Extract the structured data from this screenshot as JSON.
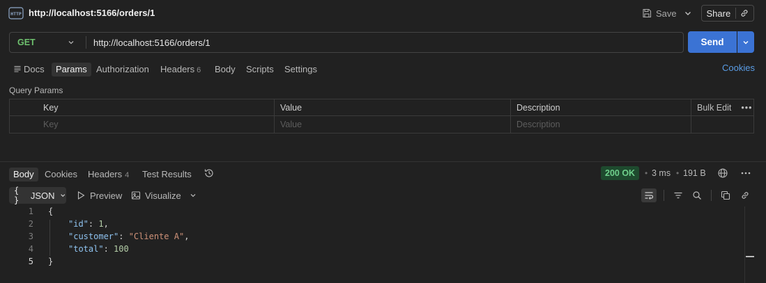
{
  "request": {
    "title": "http://localhost:5166/orders/1",
    "method": "GET",
    "url": "http://localhost:5166/orders/1"
  },
  "toolbar": {
    "save_label": "Save",
    "share_label": "Share",
    "send_label": "Send"
  },
  "request_tabs": {
    "docs": "Docs",
    "params": "Params",
    "authorization": "Authorization",
    "headers": "Headers",
    "headers_count": "6",
    "body": "Body",
    "scripts": "Scripts",
    "settings": "Settings",
    "cookies": "Cookies"
  },
  "query_params": {
    "label": "Query Params",
    "columns": {
      "key": "Key",
      "value": "Value",
      "description": "Description"
    },
    "bulk_edit": "Bulk Edit",
    "placeholders": {
      "key": "Key",
      "value": "Value",
      "description": "Description"
    }
  },
  "response": {
    "tabs": {
      "body": "Body",
      "cookies": "Cookies",
      "headers": "Headers",
      "headers_count": "4",
      "test_results": "Test Results"
    },
    "status": "200 OK",
    "time": "3 ms",
    "size": "191 B",
    "format": "JSON",
    "preview": "Preview",
    "visualize": "Visualize",
    "line_numbers": [
      "1",
      "2",
      "3",
      "4",
      "5"
    ],
    "body": {
      "open": "{",
      "close": "}",
      "fields": [
        {
          "key": "\"id\"",
          "value": "1",
          "kind": "num",
          "comma": true
        },
        {
          "key": "\"customer\"",
          "value": "\"Cliente A\"",
          "kind": "str",
          "comma": true
        },
        {
          "key": "\"total\"",
          "value": "100",
          "kind": "num",
          "comma": false
        }
      ]
    }
  },
  "colors": {
    "accent": "#3b73d4",
    "method_get": "#6ec06e",
    "status_ok": "#6fd08c",
    "link": "#5a9de6"
  },
  "icons": [
    "http-icon",
    "save-icon",
    "chevron-down-icon",
    "link-icon",
    "docs-icon",
    "history-icon",
    "globe-icon",
    "more-icon",
    "play-icon",
    "image-icon",
    "wrap-icon",
    "filter-icon",
    "search-icon",
    "copy-icon"
  ]
}
